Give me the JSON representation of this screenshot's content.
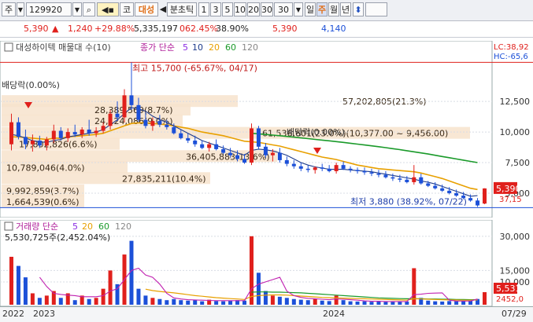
{
  "toolbar": {
    "market_label": "주",
    "stock_code": "129920",
    "search_icon": "search-icon",
    "sound_icon": "speaker-icon",
    "prefix_label": "코",
    "stock_name": "대성",
    "nav_left": "◀",
    "tick_label": "분초틱",
    "intervals": [
      "1",
      "3",
      "5",
      "10",
      "20",
      "30"
    ],
    "count_value": "30",
    "day": "일",
    "week": "주",
    "month": "월",
    "year": "년",
    "updown_icon": "up-down-arrow-icon"
  },
  "quote": {
    "price": "5,390",
    "change": "1,240",
    "change_pct": "+29.88%",
    "volume": "5,335,197",
    "vol_pct": "062.45%",
    "ratio": "38.90%",
    "price2": "5,390",
    "last": "4,140"
  },
  "colors": {
    "up": "#e0201c",
    "down": "#1c50d8",
    "ma5": "#8a2be2",
    "ma10": "#1e3c8c",
    "ma20": "#e8a000",
    "ma60": "#1a9a2a",
    "ma120": "#888888"
  },
  "chart_data": {
    "type": "candlestick",
    "title": "대성하이텍 매물대 수(10)",
    "legend_main": {
      "label": "종가 단순",
      "periods": [
        "5",
        "10",
        "20",
        "60",
        "120"
      ]
    },
    "legend_volume": {
      "label": "거래량 단순",
      "periods": [
        "5",
        "20",
        "60",
        "120"
      ]
    },
    "volume_readout": "5,530,725주(2,452.04%)",
    "y_axis": {
      "ticks": [
        "12,500",
        "10,000",
        "7,500",
        "5,000"
      ],
      "ylim": [
        3200,
        16300
      ]
    },
    "y_volume": {
      "ticks": [
        "30,000",
        "15,000",
        "10,000"
      ]
    },
    "corner_labels": {
      "lc": "LC:38,92",
      "hc": "HC:-65,6"
    },
    "price_badge": "5,390",
    "pct_label": "37,15",
    "vol_badge": "5,531",
    "vol_label": "2452,0",
    "x_labels": [
      "2022",
      "2023",
      "2024",
      "07/29"
    ],
    "high_annotation": {
      "text": "최고 15,700 (-65.67%, 04/17)",
      "value": 15700
    },
    "low_annotation": {
      "text": "최저 3,880 (38.92%, 07/22)",
      "value": 3880
    },
    "ex_div_labels": [
      "배당락(0.00%)",
      "배당락(0.00%)"
    ],
    "volume_profile": [
      {
        "text": "57,202,805(21.3%)",
        "price": 12500
      },
      {
        "text": "61,536,601(23.0%)(10,377.00 ~ 9,456.00)",
        "price": 9900
      },
      {
        "text": "28,389,569(8.7%)",
        "price": 11800
      },
      {
        "text": "24,124,086(9.0%)",
        "price": 10900
      },
      {
        "text": "17,802,826(6.6%)",
        "price": 9000
      },
      {
        "text": "36,405,883(13.6%)",
        "price": 8000
      },
      {
        "text": "10,789,046(4.0%)",
        "price": 7100
      },
      {
        "text": "27,835,211(10.4%)",
        "price": 6200
      },
      {
        "text": "9,992,859(3.7%)",
        "price": 5200
      },
      {
        "text": "1,664,539(0.6%)",
        "price": 4300
      }
    ],
    "candles": [
      {
        "o": 9000,
        "h": 11500,
        "l": 8500,
        "c": 10800
      },
      {
        "o": 10800,
        "h": 11200,
        "l": 9400,
        "c": 9600
      },
      {
        "o": 9600,
        "h": 10200,
        "l": 8600,
        "c": 9000
      },
      {
        "o": 9000,
        "h": 9800,
        "l": 8400,
        "c": 9300
      },
      {
        "o": 9300,
        "h": 9700,
        "l": 8700,
        "c": 8900
      },
      {
        "o": 8900,
        "h": 9600,
        "l": 8500,
        "c": 9400
      },
      {
        "o": 9400,
        "h": 10600,
        "l": 9100,
        "c": 10100
      },
      {
        "o": 10100,
        "h": 10400,
        "l": 9300,
        "c": 9500
      },
      {
        "o": 9500,
        "h": 10300,
        "l": 9200,
        "c": 10000
      },
      {
        "o": 10000,
        "h": 10600,
        "l": 9600,
        "c": 9800
      },
      {
        "o": 9800,
        "h": 10400,
        "l": 9500,
        "c": 10200
      },
      {
        "o": 10200,
        "h": 11000,
        "l": 9700,
        "c": 9900
      },
      {
        "o": 9900,
        "h": 10400,
        "l": 9600,
        "c": 10100
      },
      {
        "o": 10100,
        "h": 10800,
        "l": 9900,
        "c": 10500
      },
      {
        "o": 10500,
        "h": 11800,
        "l": 10200,
        "c": 11500
      },
      {
        "o": 11500,
        "h": 12500,
        "l": 10900,
        "c": 11200
      },
      {
        "o": 11200,
        "h": 13500,
        "l": 10800,
        "c": 13000
      },
      {
        "o": 13000,
        "h": 15700,
        "l": 11800,
        "c": 12200
      },
      {
        "o": 12200,
        "h": 12800,
        "l": 10800,
        "c": 11000
      },
      {
        "o": 11000,
        "h": 11600,
        "l": 10300,
        "c": 10500
      },
      {
        "o": 10500,
        "h": 11200,
        "l": 10100,
        "c": 10900
      },
      {
        "o": 10900,
        "h": 11400,
        "l": 10400,
        "c": 10600
      },
      {
        "o": 10600,
        "h": 11000,
        "l": 10200,
        "c": 10400
      },
      {
        "o": 10400,
        "h": 10700,
        "l": 9800,
        "c": 9900
      },
      {
        "o": 9900,
        "h": 10200,
        "l": 9400,
        "c": 9500
      },
      {
        "o": 9500,
        "h": 9900,
        "l": 9100,
        "c": 9300
      },
      {
        "o": 9300,
        "h": 9700,
        "l": 8800,
        "c": 9000
      },
      {
        "o": 9000,
        "h": 9300,
        "l": 8600,
        "c": 8700
      },
      {
        "o": 8700,
        "h": 9200,
        "l": 8400,
        "c": 9000
      },
      {
        "o": 9000,
        "h": 9400,
        "l": 8500,
        "c": 8600
      },
      {
        "o": 8600,
        "h": 8900,
        "l": 8200,
        "c": 8300
      },
      {
        "o": 8300,
        "h": 8700,
        "l": 7900,
        "c": 8100
      },
      {
        "o": 8100,
        "h": 8500,
        "l": 7600,
        "c": 7800
      },
      {
        "o": 7800,
        "h": 8200,
        "l": 7400,
        "c": 7500
      },
      {
        "o": 7500,
        "h": 10700,
        "l": 7300,
        "c": 10300
      },
      {
        "o": 10300,
        "h": 10500,
        "l": 8600,
        "c": 8800
      },
      {
        "o": 8800,
        "h": 9100,
        "l": 7900,
        "c": 8100
      },
      {
        "o": 8100,
        "h": 8600,
        "l": 7600,
        "c": 8300
      },
      {
        "o": 8300,
        "h": 8700,
        "l": 7500,
        "c": 7700
      },
      {
        "o": 7700,
        "h": 8000,
        "l": 7200,
        "c": 7400
      },
      {
        "o": 7400,
        "h": 7700,
        "l": 7000,
        "c": 7200
      },
      {
        "o": 7200,
        "h": 7500,
        "l": 6800,
        "c": 7000
      },
      {
        "o": 7000,
        "h": 7300,
        "l": 6700,
        "c": 6900
      },
      {
        "o": 6900,
        "h": 7200,
        "l": 6600,
        "c": 7100
      },
      {
        "o": 7100,
        "h": 7400,
        "l": 6800,
        "c": 7000
      },
      {
        "o": 7000,
        "h": 7300,
        "l": 6700,
        "c": 6800
      },
      {
        "o": 6800,
        "h": 7500,
        "l": 6600,
        "c": 7300
      },
      {
        "o": 7300,
        "h": 7600,
        "l": 6900,
        "c": 7000
      },
      {
        "o": 7000,
        "h": 7200,
        "l": 6700,
        "c": 6900
      },
      {
        "o": 6900,
        "h": 7100,
        "l": 6600,
        "c": 6800
      },
      {
        "o": 6800,
        "h": 7100,
        "l": 6500,
        "c": 6700
      },
      {
        "o": 6700,
        "h": 7000,
        "l": 6400,
        "c": 6600
      },
      {
        "o": 6600,
        "h": 6900,
        "l": 6300,
        "c": 6500
      },
      {
        "o": 6500,
        "h": 6800,
        "l": 6200,
        "c": 6300
      },
      {
        "o": 6300,
        "h": 6600,
        "l": 6000,
        "c": 6200
      },
      {
        "o": 6200,
        "h": 6500,
        "l": 5900,
        "c": 6100
      },
      {
        "o": 6100,
        "h": 6400,
        "l": 5800,
        "c": 5900
      },
      {
        "o": 5900,
        "h": 7300,
        "l": 5700,
        "c": 6300
      },
      {
        "o": 6300,
        "h": 6600,
        "l": 5700,
        "c": 5800
      },
      {
        "o": 5800,
        "h": 6000,
        "l": 5500,
        "c": 5600
      },
      {
        "o": 5600,
        "h": 5900,
        "l": 5300,
        "c": 5400
      },
      {
        "o": 5400,
        "h": 5700,
        "l": 5100,
        "c": 5200
      },
      {
        "o": 5200,
        "h": 5500,
        "l": 4900,
        "c": 5000
      },
      {
        "o": 5000,
        "h": 5300,
        "l": 4700,
        "c": 4800
      },
      {
        "o": 4800,
        "h": 5100,
        "l": 4500,
        "c": 4600
      },
      {
        "o": 4600,
        "h": 4900,
        "l": 4300,
        "c": 4400
      },
      {
        "o": 4400,
        "h": 4600,
        "l": 3880,
        "c": 4000
      },
      {
        "o": 4150,
        "h": 5400,
        "l": 4100,
        "c": 5390
      }
    ],
    "volumes": [
      {
        "v": 21000,
        "up": true
      },
      {
        "v": 17000,
        "up": false
      },
      {
        "v": 12000,
        "up": false
      },
      {
        "v": 5000,
        "up": true
      },
      {
        "v": 3000,
        "up": false
      },
      {
        "v": 4000,
        "up": true
      },
      {
        "v": 6000,
        "up": true
      },
      {
        "v": 3000,
        "up": false
      },
      {
        "v": 5000,
        "up": true
      },
      {
        "v": 2000,
        "up": false
      },
      {
        "v": 4000,
        "up": true
      },
      {
        "v": 2500,
        "up": false
      },
      {
        "v": 3000,
        "up": true
      },
      {
        "v": 7000,
        "up": true
      },
      {
        "v": 15000,
        "up": true
      },
      {
        "v": 9000,
        "up": false
      },
      {
        "v": 22000,
        "up": true
      },
      {
        "v": 28000,
        "up": false
      },
      {
        "v": 7000,
        "up": false
      },
      {
        "v": 4000,
        "up": false
      },
      {
        "v": 3000,
        "up": true
      },
      {
        "v": 2500,
        "up": false
      },
      {
        "v": 2000,
        "up": false
      },
      {
        "v": 2500,
        "up": false
      },
      {
        "v": 2000,
        "up": false
      },
      {
        "v": 1800,
        "up": false
      },
      {
        "v": 2000,
        "up": false
      },
      {
        "v": 1500,
        "up": false
      },
      {
        "v": 2200,
        "up": true
      },
      {
        "v": 1600,
        "up": false
      },
      {
        "v": 1500,
        "up": false
      },
      {
        "v": 1700,
        "up": false
      },
      {
        "v": 2000,
        "up": false
      },
      {
        "v": 1800,
        "up": false
      },
      {
        "v": 30000,
        "up": true
      },
      {
        "v": 14000,
        "up": false
      },
      {
        "v": 6000,
        "up": false
      },
      {
        "v": 4000,
        "up": true
      },
      {
        "v": 3500,
        "up": false
      },
      {
        "v": 3000,
        "up": false
      },
      {
        "v": 2500,
        "up": false
      },
      {
        "v": 2200,
        "up": false
      },
      {
        "v": 2000,
        "up": false
      },
      {
        "v": 2500,
        "up": true
      },
      {
        "v": 1800,
        "up": false
      },
      {
        "v": 1600,
        "up": false
      },
      {
        "v": 4000,
        "up": true
      },
      {
        "v": 2000,
        "up": false
      },
      {
        "v": 1500,
        "up": false
      },
      {
        "v": 1400,
        "up": false
      },
      {
        "v": 1500,
        "up": false
      },
      {
        "v": 1300,
        "up": false
      },
      {
        "v": 1400,
        "up": false
      },
      {
        "v": 1200,
        "up": false
      },
      {
        "v": 1500,
        "up": false
      },
      {
        "v": 1300,
        "up": false
      },
      {
        "v": 1400,
        "up": false
      },
      {
        "v": 16000,
        "up": true
      },
      {
        "v": 3000,
        "up": false
      },
      {
        "v": 1800,
        "up": false
      },
      {
        "v": 1500,
        "up": false
      },
      {
        "v": 1400,
        "up": false
      },
      {
        "v": 1600,
        "up": false
      },
      {
        "v": 1500,
        "up": false
      },
      {
        "v": 1700,
        "up": false
      },
      {
        "v": 1800,
        "up": false
      },
      {
        "v": 2500,
        "up": false
      },
      {
        "v": 5500,
        "up": true
      }
    ],
    "ma_green": [
      null,
      null,
      null,
      null,
      null,
      null,
      null,
      null,
      null,
      null,
      null,
      null,
      null,
      null,
      null,
      null,
      null,
      null,
      null,
      null,
      null,
      null,
      null,
      null,
      null,
      null,
      null,
      null,
      null,
      null,
      null,
      null,
      null,
      null,
      9900,
      9850,
      9800,
      9750,
      9700,
      9640,
      9580,
      9520,
      9460,
      9400,
      9340,
      9280,
      9220,
      9150,
      9080,
      9010,
      8940,
      8870,
      8800,
      8720,
      8640,
      8560,
      8470,
      8380,
      8290,
      8200,
      8100,
      8000,
      7900,
      7800,
      7700,
      7600,
      7500
    ],
    "ma_orange": [
      9600,
      9600,
      9550,
      9500,
      9450,
      9400,
      9500,
      9500,
      9600,
      9650,
      9700,
      9750,
      9800,
      9900,
      10100,
      10300,
      10500,
      10700,
      10750,
      10750,
      10700,
      10650,
      10600,
      10500,
      10400,
      10300,
      10150,
      10000,
      9900,
      9800,
      9700,
      9550,
      9400,
      9250,
      9200,
      9150,
      9050,
      8950,
      8850,
      8700,
      8550,
      8400,
      8250,
      8100,
      7950,
      7850,
      7750,
      7600,
      7450,
      7300,
      7200,
      7100,
      7000,
      6950,
      6900,
      6850,
      6800,
      6750,
      6650,
      6500,
      6350,
      6200,
      6000,
      5800,
      5600,
      5400,
      5300
    ],
    "ma_navy": [
      9800,
      9700,
      9500,
      9300,
      9200,
      9150,
      9300,
      9400,
      9600,
      9700,
      9800,
      9900,
      10000,
      10200,
      10600,
      11000,
      11500,
      12000,
      11900,
      11700,
      11300,
      11000,
      10800,
      10500,
      10200,
      9900,
      9600,
      9300,
      9100,
      8900,
      8700,
      8500,
      8300,
      8100,
      8500,
      8600,
      8550,
      8450,
      8300,
      8100,
      7800,
      7500,
      7300,
      7150,
      7050,
      6950,
      6950,
      6950,
      6900,
      6850,
      6800,
      6750,
      6650,
      6550,
      6450,
      6350,
      6250,
      6150,
      6000,
      5900,
      5750,
      5550,
      5350,
      5150,
      4950,
      4750,
      4800
    ],
    "ma_purple_vol": [
      null,
      null,
      null,
      null,
      12000,
      8000,
      5000,
      4500,
      4200,
      4000,
      3500,
      3500,
      3500,
      4000,
      6000,
      7000,
      11000,
      15000,
      16000,
      13000,
      12000,
      9000,
      5000,
      3000,
      2500,
      2200,
      2100,
      2000,
      1900,
      1800,
      1800,
      1800,
      1800,
      1800,
      7000,
      9000,
      10000,
      11000,
      12000,
      6000,
      4000,
      3200,
      2800,
      2600,
      2400,
      2200,
      2500,
      2400,
      2200,
      2000,
      1700,
      1500,
      1500,
      1400,
      1400,
      1400,
      1400,
      4400,
      4600,
      5000,
      5100,
      5200,
      2000,
      1600,
      1600,
      1600,
      2500
    ],
    "ma_orange_vol": [
      null,
      null,
      null,
      null,
      null,
      null,
      null,
      null,
      null,
      null,
      null,
      null,
      null,
      null,
      null,
      null,
      null,
      null,
      null,
      6800,
      6200,
      5800,
      5500,
      5200,
      4800,
      4400,
      4000,
      3700,
      3400,
      3100,
      2900,
      2700,
      2500,
      2300,
      3600,
      4000,
      4200,
      4300,
      4300,
      4200,
      4000,
      3800,
      3600,
      3400,
      3200,
      3100,
      3000,
      2900,
      2800,
      2700,
      2600,
      2500,
      2400,
      2300,
      2200,
      2100,
      2000,
      2600,
      2500,
      2400,
      2300,
      2200,
      2100,
      2050,
      2000,
      2000,
      2100
    ],
    "ma_green_vol": [
      null,
      null,
      null,
      null,
      null,
      null,
      null,
      null,
      null,
      null,
      null,
      null,
      null,
      null,
      null,
      null,
      null,
      null,
      null,
      null,
      null,
      null,
      null,
      null,
      null,
      null,
      null,
      null,
      null,
      null,
      null,
      null,
      null,
      null,
      5500,
      5600,
      5600,
      5500,
      5500,
      5400,
      5300,
      5200,
      5000,
      4800,
      4600,
      4400,
      4200,
      4000,
      3800,
      3600,
      3400,
      3200,
      3000,
      2900,
      2800,
      2700,
      2600,
      2600,
      2600,
      2500,
      2500,
      2400,
      2400,
      2300,
      2300,
      2200,
      2200
    ]
  }
}
